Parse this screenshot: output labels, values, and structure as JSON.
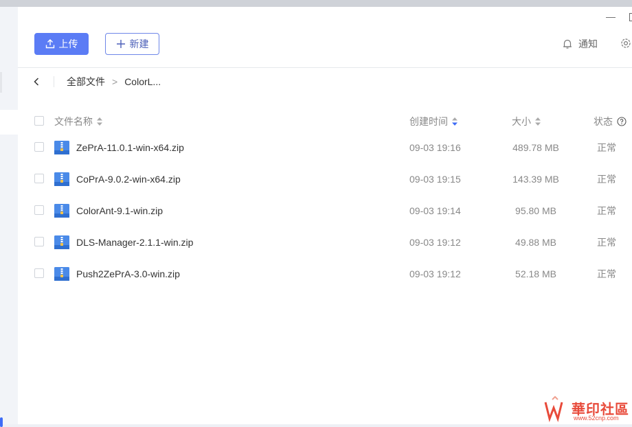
{
  "toolbar": {
    "upload_label": "上传",
    "new_label": "新建"
  },
  "header": {
    "notify_label": "通知"
  },
  "breadcrumb": {
    "root": "全部文件",
    "current": "ColorL..."
  },
  "columns": {
    "name": "文件名称",
    "created": "创建时间",
    "size": "大小",
    "status": "状态"
  },
  "files": [
    {
      "name": "ZePrA-11.0.1-win-x64.zip",
      "created": "09-03 19:16",
      "size": "489.78 MB",
      "status": "正常"
    },
    {
      "name": "CoPrA-9.0.2-win-x64.zip",
      "created": "09-03 19:15",
      "size": "143.39 MB",
      "status": "正常"
    },
    {
      "name": "ColorAnt-9.1-win.zip",
      "created": "09-03 19:14",
      "size": "95.80 MB",
      "status": "正常"
    },
    {
      "name": "DLS-Manager-2.1.1-win.zip",
      "created": "09-03 19:12",
      "size": "49.88 MB",
      "status": "正常"
    },
    {
      "name": "Push2ZePrA-3.0-win.zip",
      "created": "09-03 19:12",
      "size": "52.18 MB",
      "status": "正常"
    }
  ],
  "watermark": {
    "title": "華印社區",
    "url": "www.52cnp.com"
  },
  "colors": {
    "accent": "#5b7cf5",
    "sort_active": "#3e6cf6",
    "zip_icon": "#4a8ae8"
  }
}
